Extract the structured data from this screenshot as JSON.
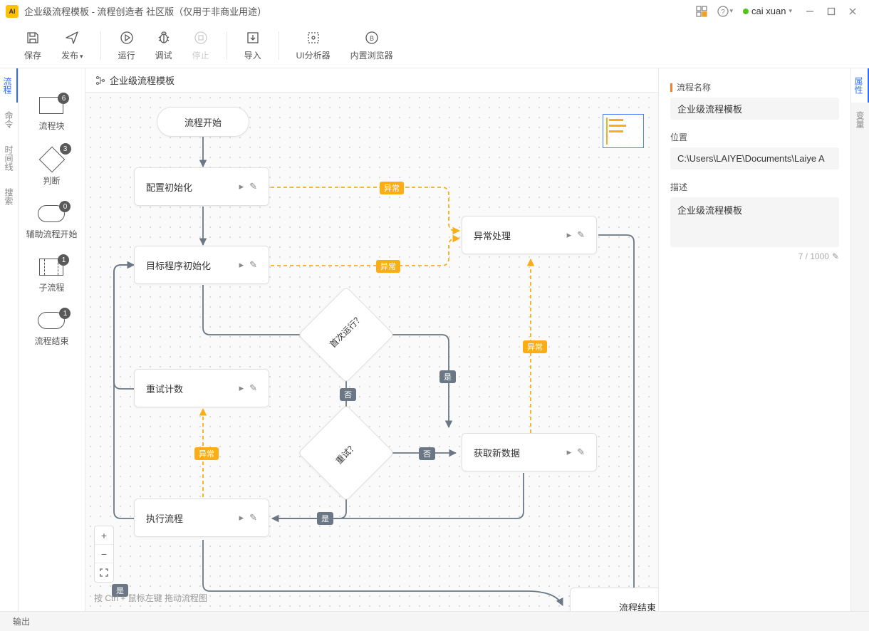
{
  "title": "企业级流程模板 - 流程创造者 社区版（仅用于非商业用途）",
  "user": "cai xuan",
  "toolbar": {
    "save": "保存",
    "publish": "发布",
    "run": "运行",
    "debug": "调试",
    "stop": "停止",
    "import": "导入",
    "ui_analyzer": "UI分析器",
    "builtin_browser": "内置浏览器"
  },
  "left_rail": [
    "流程",
    "命令",
    "时间线",
    "搜索"
  ],
  "palette": [
    {
      "label": "流程块",
      "badge": "6"
    },
    {
      "label": "判断",
      "badge": "3"
    },
    {
      "label": "辅助流程开始",
      "badge": "0"
    },
    {
      "label": "子流程",
      "badge": "1"
    },
    {
      "label": "流程结束",
      "badge": "1"
    }
  ],
  "breadcrumb": "企业级流程模板",
  "nodes": {
    "start": "流程开始",
    "config_init": "配置初始化",
    "target_init": "目标程序初始化",
    "first_run": "首次运行？",
    "retry_count": "重试计数",
    "retry": "重试？",
    "exec_flow": "执行流程",
    "exception": "异常处理",
    "get_data": "获取新数据",
    "end": "流程结束"
  },
  "edge_labels": {
    "exception": "异常",
    "yes": "是",
    "no": "否"
  },
  "canvas_hint": "按 Ctrl + 鼠标左键 拖动流程图",
  "right_rail": [
    "属性",
    "变量"
  ],
  "properties": {
    "name_label": "流程名称",
    "name_value": "企业级流程模板",
    "location_label": "位置",
    "location_value": "C:\\Users\\LAIYE\\Documents\\Laiye A",
    "desc_label": "描述",
    "desc_value": "企业级流程模板",
    "char_count": "7 / 1000"
  },
  "bottom": "输出"
}
